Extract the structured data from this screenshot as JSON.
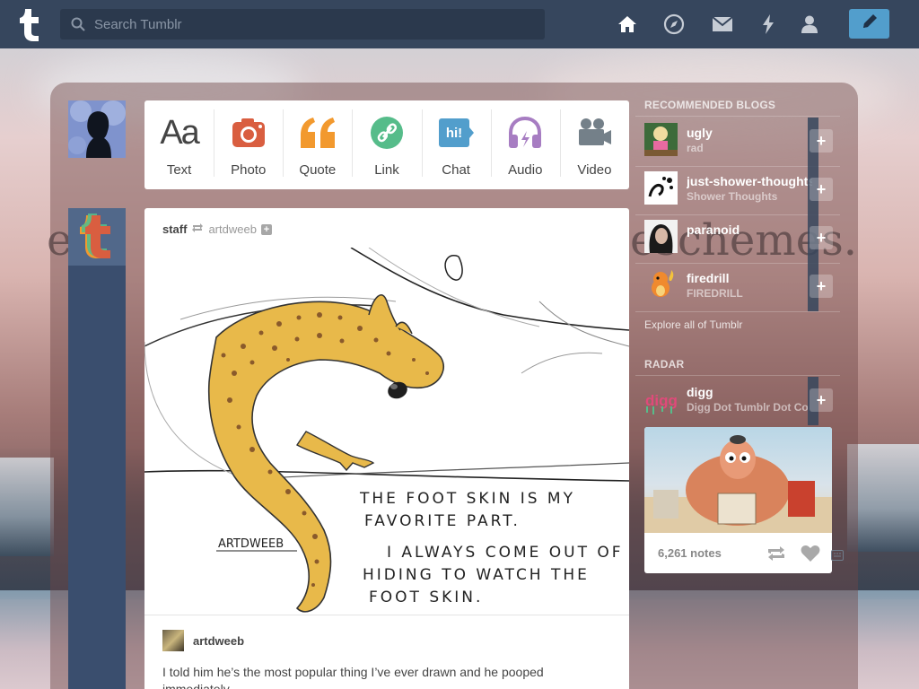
{
  "topbar": {
    "search_placeholder": "Search Tumblr",
    "nav_icons": [
      "home-icon",
      "explore-icon",
      "inbox-icon",
      "activity-icon",
      "account-icon"
    ],
    "compose_icon": "pencil-icon",
    "bg_color": "#36465d",
    "accent": "#529ecc"
  },
  "background": {
    "text_left": "e",
    "text_right": "eschemes."
  },
  "post_types": [
    {
      "label": "Text",
      "icon": "text-icon",
      "color": "#444444"
    },
    {
      "label": "Photo",
      "icon": "camera-icon",
      "color": "#d95e40"
    },
    {
      "label": "Quote",
      "icon": "quote-icon",
      "color": "#f2992e"
    },
    {
      "label": "Link",
      "icon": "link-icon",
      "color": "#56bc8a"
    },
    {
      "label": "Chat",
      "icon": "chat-icon",
      "color": "#529ecc"
    },
    {
      "label": "Audio",
      "icon": "headphones-icon",
      "color": "#a77dc2"
    },
    {
      "label": "Video",
      "icon": "video-camera-icon",
      "color": "#748089"
    }
  ],
  "post": {
    "author": "staff",
    "reblogged_from": "artdweeb",
    "art_signature": "ARTDWEEB",
    "art_text_1": "THE FOOT SKIN IS MY",
    "art_text_2": "FAVORITE PART.",
    "art_text_3": "I ALWAYS COME OUT OF",
    "art_text_4": "HIDING TO WATCH THE",
    "art_text_5": "FOOT SKIN.",
    "caption_author": "artdweeb",
    "caption": "I told him he’s the most popular thing I’ve ever drawn and he pooped immediately."
  },
  "sidebar": {
    "recommended_title": "RECOMMENDED BLOGS",
    "blogs": [
      {
        "name": "ugly",
        "subtitle": "rad"
      },
      {
        "name": "just-shower-thoughts",
        "subtitle": "Shower Thoughts"
      },
      {
        "name": "paranoid",
        "subtitle": ""
      },
      {
        "name": "firedrill",
        "subtitle": "FIREDRILL"
      }
    ],
    "explore": "Explore all of Tumblr",
    "radar_title": "RADAR",
    "radar_blog": {
      "name": "digg",
      "subtitle": "Digg Dot Tumblr Dot Com"
    },
    "radar_notes": "6,261 notes",
    "add_label": "+"
  }
}
